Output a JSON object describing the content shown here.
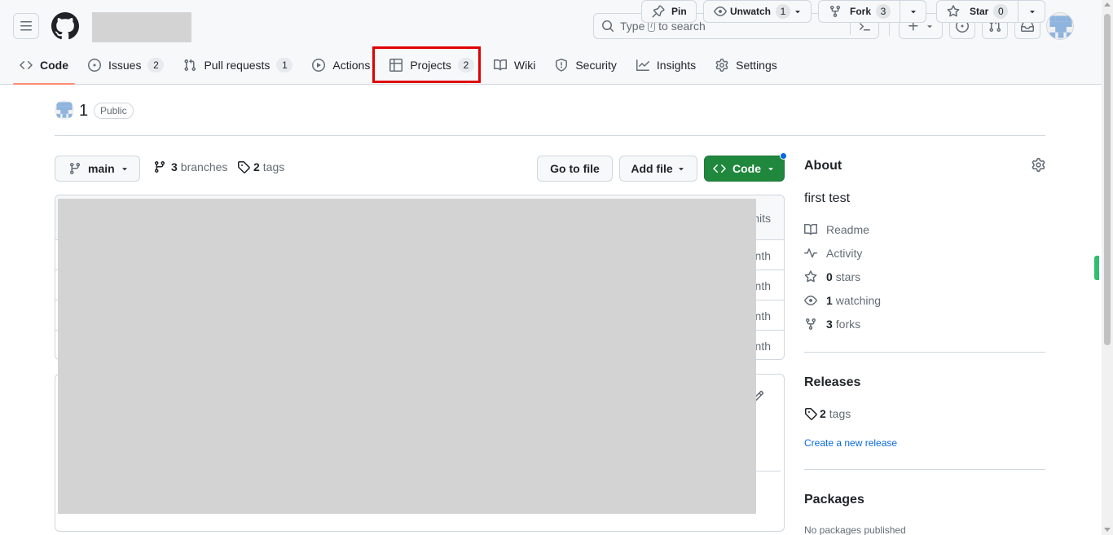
{
  "header": {
    "search_placeholder_before": "Type",
    "search_key": "/",
    "search_placeholder_after": "to search",
    "icons": [
      "hamburger-icon",
      "github-logo",
      "search-icon",
      "command-palette-icon",
      "plus-icon",
      "issue-opened-icon",
      "pull-request-icon",
      "inbox-icon"
    ]
  },
  "tabs": [
    {
      "label": "Code",
      "icon": "code-icon",
      "selected": true
    },
    {
      "label": "Issues",
      "icon": "issue-opened-icon",
      "counter": "2"
    },
    {
      "label": "Pull requests",
      "icon": "pull-request-icon",
      "counter": "1"
    },
    {
      "label": "Actions",
      "icon": "play-icon"
    },
    {
      "label": "Projects",
      "icon": "table-icon",
      "counter": "2",
      "highlighted": true
    },
    {
      "label": "Wiki",
      "icon": "book-icon"
    },
    {
      "label": "Security",
      "icon": "shield-icon"
    },
    {
      "label": "Insights",
      "icon": "graph-icon"
    },
    {
      "label": "Settings",
      "icon": "gear-icon"
    }
  ],
  "repo": {
    "name": "1",
    "visibility": "Public",
    "pin_label": "Pin",
    "watch_label": "Unwatch",
    "watch_count": "1",
    "fork_label": "Fork",
    "fork_count": "3",
    "star_label": "Star",
    "star_count": "0"
  },
  "file_nav": {
    "branch": "main",
    "branches_count": "3",
    "branches_label": "branches",
    "tags_count": "2",
    "tags_label": "tags",
    "go_to_file": "Go to file",
    "add_file": "Add file",
    "code_button": "Code"
  },
  "file_list": {
    "header_tail": "nits",
    "row_tails": [
      "nth",
      "nth",
      "nth",
      "nth"
    ]
  },
  "sidebar": {
    "about_title": "About",
    "description": "first test",
    "items": [
      {
        "icon": "book-icon",
        "bold": "",
        "label": "Readme"
      },
      {
        "icon": "pulse-icon",
        "bold": "",
        "label": "Activity"
      },
      {
        "icon": "star-icon",
        "bold": "0",
        "label": "stars"
      },
      {
        "icon": "eye-icon",
        "bold": "1",
        "label": "watching"
      },
      {
        "icon": "fork-icon",
        "bold": "3",
        "label": "forks"
      }
    ],
    "releases_title": "Releases",
    "releases_tags_count": "2",
    "releases_tags_label": "tags",
    "create_release": "Create a new release",
    "packages_title": "Packages",
    "packages_empty": "No packages published"
  },
  "colors": {
    "accent_blue": "#0969da",
    "code_button_green": "#1f883d",
    "selected_tab_underline": "#fd8c73",
    "highlight_box": "#e00000"
  }
}
